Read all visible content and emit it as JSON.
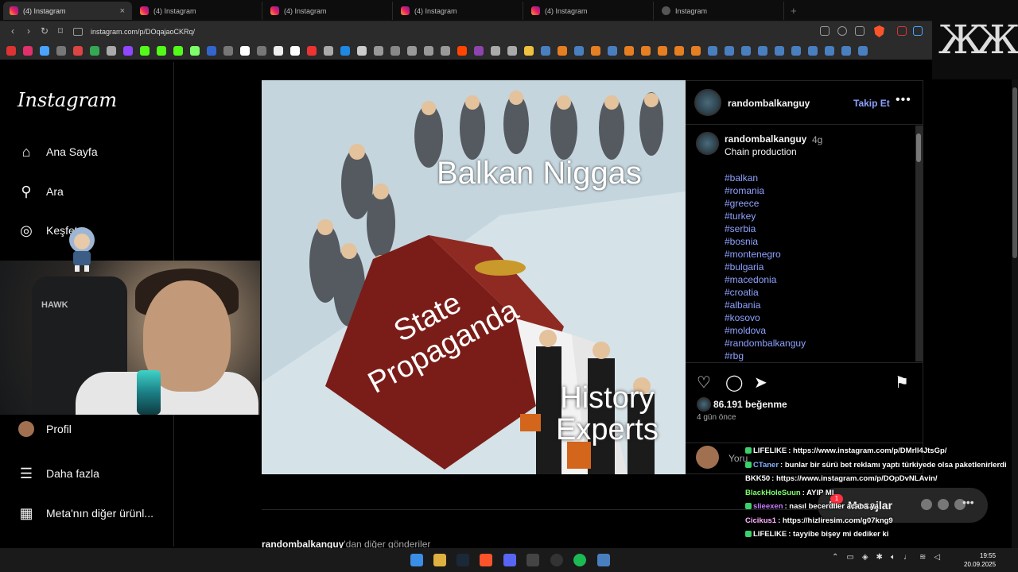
{
  "browser": {
    "tabs": [
      {
        "label": "(4) Instagram",
        "active": true
      },
      {
        "label": "(4) Instagram",
        "active": false
      },
      {
        "label": "(4) Instagram",
        "active": false
      },
      {
        "label": "(4) Instagram",
        "active": false
      },
      {
        "label": "(4) Instagram",
        "active": false
      },
      {
        "label": "Instagram",
        "active": false
      }
    ],
    "new_tab_symbol": "+",
    "close_symbol": "×",
    "url": "instagram.com/p/DOqajaoCKRq/"
  },
  "instagram": {
    "logo": "Instagram",
    "nav": [
      {
        "label": "Ana Sayfa",
        "icon": "home-icon"
      },
      {
        "label": "Ara",
        "icon": "search-icon"
      },
      {
        "label": "Keşfet",
        "icon": "compass-icon"
      },
      {
        "label": "Profil",
        "icon": "profile-icon"
      },
      {
        "label": "Daha fazla",
        "icon": "menu-icon"
      },
      {
        "label": "Meta'nın diğer ürünl...",
        "icon": "apps-icon"
      }
    ],
    "post": {
      "image_texts": {
        "top": "Balkan Niggas",
        "book": [
          "State",
          "Propaganda"
        ],
        "bottom": [
          "History",
          "Experts"
        ]
      },
      "username": "randombalkanguy",
      "follow_label": "Takip Et",
      "more_label": "•••",
      "caption_user": "randombalkanguy",
      "caption_time": "4g",
      "caption_text": "Chain production",
      "hashtags": [
        "#balkan",
        "#romania",
        "#greece",
        "#turkey",
        "#serbia",
        "#bosnia",
        "#montenegro",
        "#bulgaria",
        "#macedonia",
        "#croatia",
        "#albania",
        "#kosovo",
        "#moldova",
        "#randombalkanguy",
        "#rbg"
      ],
      "likes": "86.191 beğenme",
      "time_ago": "4 gün önce",
      "comment_placeholder": "Yoru"
    },
    "more_posts_user": "randombalkanguy",
    "more_posts_suffix": "'dan diğer gönderiler",
    "messages": {
      "label": "Mesajlar",
      "badge": "1"
    }
  },
  "chat": [
    {
      "user": "LIFELIKE",
      "text": ": https://www.instagram.com/p/DMrll4JtsGp/",
      "color": "#ffffff",
      "badge": true
    },
    {
      "user": "CTaner",
      "text": ": bunlar bir sürü bet reklamı yaptı türkiyede olsa paketlenirlerdi",
      "color": "#7fb2ff",
      "badge": true
    },
    {
      "user": "BKK50",
      "text": ": https://www.instagram.com/p/DOpDvNLAvin/",
      "color": "#ffffff",
      "badge": false
    },
    {
      "user": "BlackHoleSuun",
      "text": ": AYIP MI",
      "color": "#7dff6a",
      "badge": false
    },
    {
      "user": "slieexen",
      "text": ": nasıl becerdiler acaba ya",
      "color": "#c77dff",
      "badge": true
    },
    {
      "user": "Cicikus1",
      "text": ": https://hizliresim.com/g07kng9",
      "color": "#ffb3ff",
      "badge": false
    },
    {
      "user": "LIFELIKE",
      "text": ": tayyibe bişey mi dediker ki",
      "color": "#ffffff",
      "badge": true
    }
  ],
  "webcam": {
    "chair_brand": "HAWK"
  },
  "taskbar": {
    "time": "19:55",
    "date": "20.09.2025"
  },
  "colors": {
    "link": "#8ea2ff",
    "background": "#000000",
    "badge": "#ff3040",
    "brave": "#fb542b"
  }
}
